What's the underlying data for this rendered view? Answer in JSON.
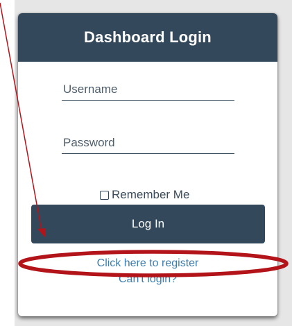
{
  "card": {
    "title": "Dashboard Login",
    "username_placeholder": "Username",
    "password_placeholder": "Password",
    "remember_label": "Remember Me",
    "remember_checked": false,
    "login_label": "Log In",
    "register_link": "Click here to register",
    "cant_login_link": "Can't login?"
  },
  "annotation": {
    "color": "#b3141a",
    "shapes": [
      "arrow",
      "ellipse"
    ]
  },
  "colors": {
    "header": "#33495b",
    "button": "#33495b",
    "link": "#3b7db0",
    "background": "#e6e6e6"
  }
}
